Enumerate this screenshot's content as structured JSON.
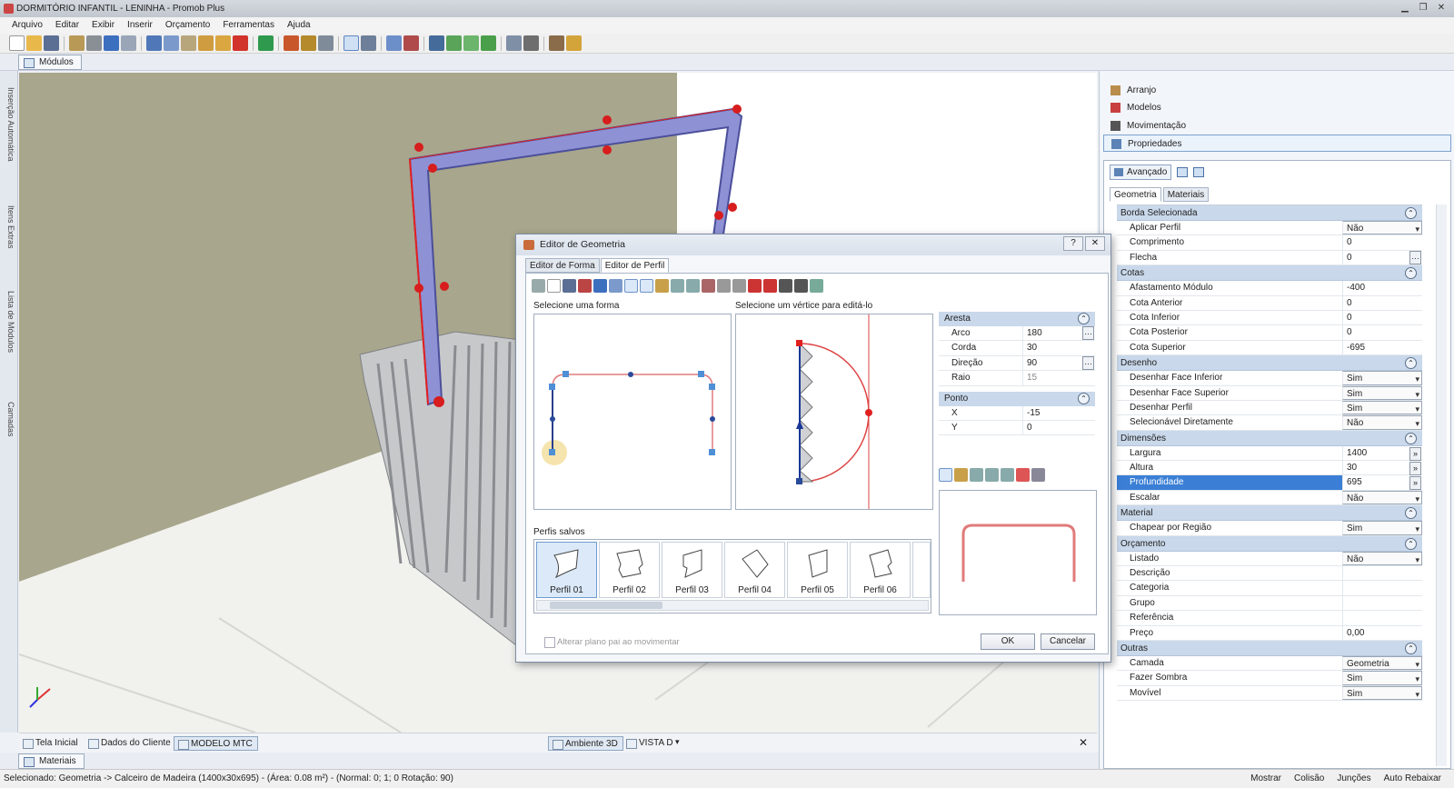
{
  "window": {
    "title": "DORMITÓRIO INFANTIL - LENINHA - Promob Plus"
  },
  "menu": [
    "Arquivo",
    "Editar",
    "Exibir",
    "Inserir",
    "Orçamento",
    "Ferramentas",
    "Ajuda"
  ],
  "modules_tab": "Módulos",
  "left_tabs": [
    "Inserção Automática",
    "Itens Extras",
    "Lista de Módulos",
    "Camadas"
  ],
  "viewport_tabs": [
    "Tela Inicial",
    "Dados do Cliente",
    "MODELO MTC"
  ],
  "view_buttons": {
    "ambiente": "Ambiente 3D",
    "vista": "VISTA D"
  },
  "materials_tab": "Materiais",
  "status": {
    "text": "Selecionado: Geometria -> Calceiro de Madeira (1400x30x695) - (Área: 0.08 m²) - (Normal: 0; 1; 0 Rotação: 90)",
    "mostrar": "Mostrar",
    "colisao": "Colisão",
    "juncoes": "Junções",
    "auto_rebaixar": "Auto Rebaixar"
  },
  "right_panel": {
    "nav": [
      "Arranjo",
      "Modelos",
      "Movimentação",
      "Propriedades"
    ],
    "advanced": "Avançado",
    "tabs": [
      "Geometria",
      "Materiais"
    ],
    "groups": [
      {
        "name": "Borda Selecionada",
        "rows": [
          [
            "Aplicar Perfil",
            "Não",
            "dd"
          ],
          [
            "Comprimento",
            "0",
            ""
          ],
          [
            "Flecha",
            "0",
            "eb"
          ]
        ]
      },
      {
        "name": "Cotas",
        "rows": [
          [
            "Afastamento Módulo",
            "-400",
            ""
          ],
          [
            "Cota Anterior",
            "0",
            ""
          ],
          [
            "Cota Inferior",
            "0",
            ""
          ],
          [
            "Cota Posterior",
            "0",
            ""
          ],
          [
            "Cota Superior",
            "-695",
            ""
          ]
        ]
      },
      {
        "name": "Desenho",
        "rows": [
          [
            "Desenhar Face Inferior",
            "Sim",
            "dd"
          ],
          [
            "Desenhar Face Superior",
            "Sim",
            "dd"
          ],
          [
            "Desenhar Perfil",
            "Sim",
            "dd"
          ],
          [
            "Selecionável Diretamente",
            "Não",
            "dd"
          ]
        ]
      },
      {
        "name": "Dimensões",
        "rows": [
          [
            "Largura",
            "1400",
            "ab"
          ],
          [
            "Altura",
            "30",
            "ab"
          ],
          [
            "Profundidade",
            "695",
            "ab",
            "sel"
          ],
          [
            "Escalar",
            "Não",
            "dd"
          ]
        ]
      },
      {
        "name": "Material",
        "rows": [
          [
            "Chapear por Região",
            "Sim",
            "dd"
          ]
        ]
      },
      {
        "name": "Orçamento",
        "rows": [
          [
            "Listado",
            "Não",
            "dd"
          ],
          [
            "Descrição",
            "",
            ""
          ],
          [
            "Categoria",
            "",
            ""
          ],
          [
            "Grupo",
            "",
            ""
          ],
          [
            "Referência",
            "",
            ""
          ],
          [
            "Preço",
            "0,00",
            ""
          ]
        ]
      },
      {
        "name": "Outras",
        "rows": [
          [
            "Camada",
            "Geometria",
            "dd"
          ],
          [
            "Fazer Sombra",
            "Sim",
            "dd"
          ],
          [
            "Movível",
            "Sim",
            "dd"
          ]
        ]
      }
    ]
  },
  "dialog": {
    "title": "Editor de Geometria",
    "tabs": [
      "Editor de Forma",
      "Editor de Perfil"
    ],
    "select_shape": "Selecione uma forma",
    "select_vertex": "Selecione um vértice para editá-lo",
    "saved_profiles": "Perfis salvos",
    "profiles": [
      "Perfil 01",
      "Perfil 02",
      "Perfil 03",
      "Perfil 04",
      "Perfil 05",
      "Perfil 06"
    ],
    "aresta": {
      "title": "Aresta",
      "rows": [
        [
          "Arco",
          "180"
        ],
        [
          "Corda",
          "30"
        ],
        [
          "Direção",
          "90"
        ],
        [
          "Raio",
          "15"
        ]
      ]
    },
    "ponto": {
      "title": "Ponto",
      "rows": [
        [
          "X",
          "-15"
        ],
        [
          "Y",
          "0"
        ]
      ]
    },
    "checkbox": "Alterar plano pai ao movimentar",
    "ok": "OK",
    "cancel": "Cancelar"
  }
}
